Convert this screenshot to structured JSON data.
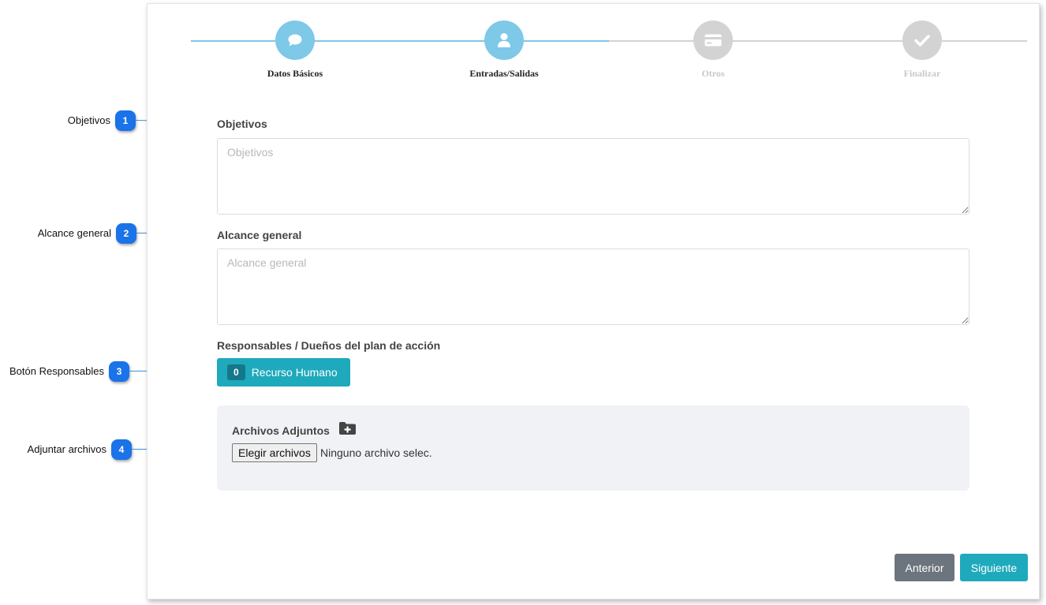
{
  "callouts": [
    {
      "number": "1",
      "label": "Objetivos"
    },
    {
      "number": "2",
      "label": "Alcance general"
    },
    {
      "number": "3",
      "label": "Botón Responsables"
    },
    {
      "number": "4",
      "label": "Adjuntar archivos"
    }
  ],
  "wizard": {
    "steps": [
      {
        "label": "Datos Básicos",
        "icon": "chat-bubble-icon",
        "state": "completed"
      },
      {
        "label": "Entradas/Salidas",
        "icon": "user-icon",
        "state": "active"
      },
      {
        "label": "Otros",
        "icon": "card-icon",
        "state": "pending"
      },
      {
        "label": "Finalizar",
        "icon": "check-icon",
        "state": "pending"
      }
    ]
  },
  "form": {
    "objetivos": {
      "label": "Objetivos",
      "placeholder": "Objetivos",
      "value": ""
    },
    "alcance": {
      "label": "Alcance general",
      "placeholder": "Alcance general",
      "value": ""
    },
    "responsables": {
      "label": "Responsables / Dueños del plan de acción",
      "count": "0",
      "button_label": "Recurso Humano"
    },
    "attachments": {
      "title": "Archivos Adjuntos",
      "icon": "folder-plus-icon",
      "choose_label": "Elegir archivos",
      "status": "Ninguno archivo selec."
    }
  },
  "navigation": {
    "prev_label": "Anterior",
    "next_label": "Siguiente"
  },
  "colors": {
    "accent": "#1fa9bd",
    "step_active": "#7ec8e8",
    "step_inactive": "#d3d3d3",
    "callout": "#1a73e8",
    "secondary": "#6c757d"
  }
}
